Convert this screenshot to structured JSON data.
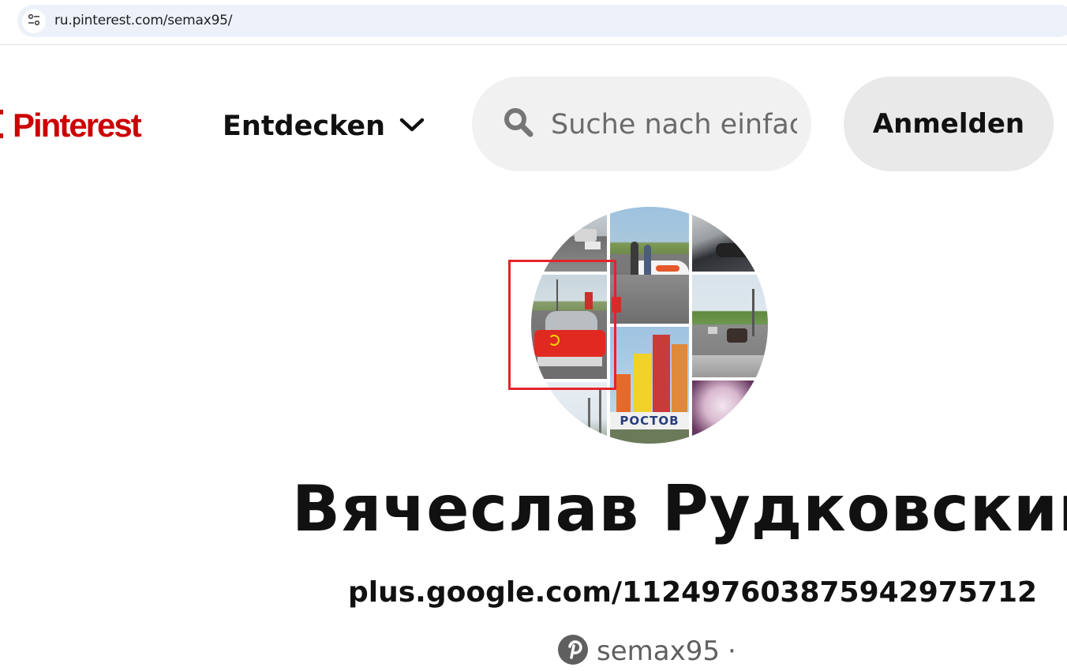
{
  "browser": {
    "url": "ru.pinterest.com/semax95/",
    "site_info_icon": "tune-icon"
  },
  "header": {
    "logo_text": "Pinterest",
    "logo_icon": "pinterest-logo-icon",
    "explore_label": "Entdecken",
    "explore_icon": "chevron-down-icon",
    "search_placeholder": "Suche nach einfachen Abendessen",
    "search_icon": "search-icon",
    "login_label": "Anmelden"
  },
  "profile": {
    "name": "Вячеслав Рудковский",
    "website": "plus.google.com/112497603875942975712",
    "username": "semax95",
    "username_separator": "·",
    "username_icon": "pinterest-logo-icon",
    "avatar_sign_text": "РОСТОВ"
  },
  "colors": {
    "brand_red": "#cc0000",
    "highlight_red": "#e3242b",
    "search_bg": "#f1f1f1",
    "button_bg": "#e9e9e9"
  }
}
